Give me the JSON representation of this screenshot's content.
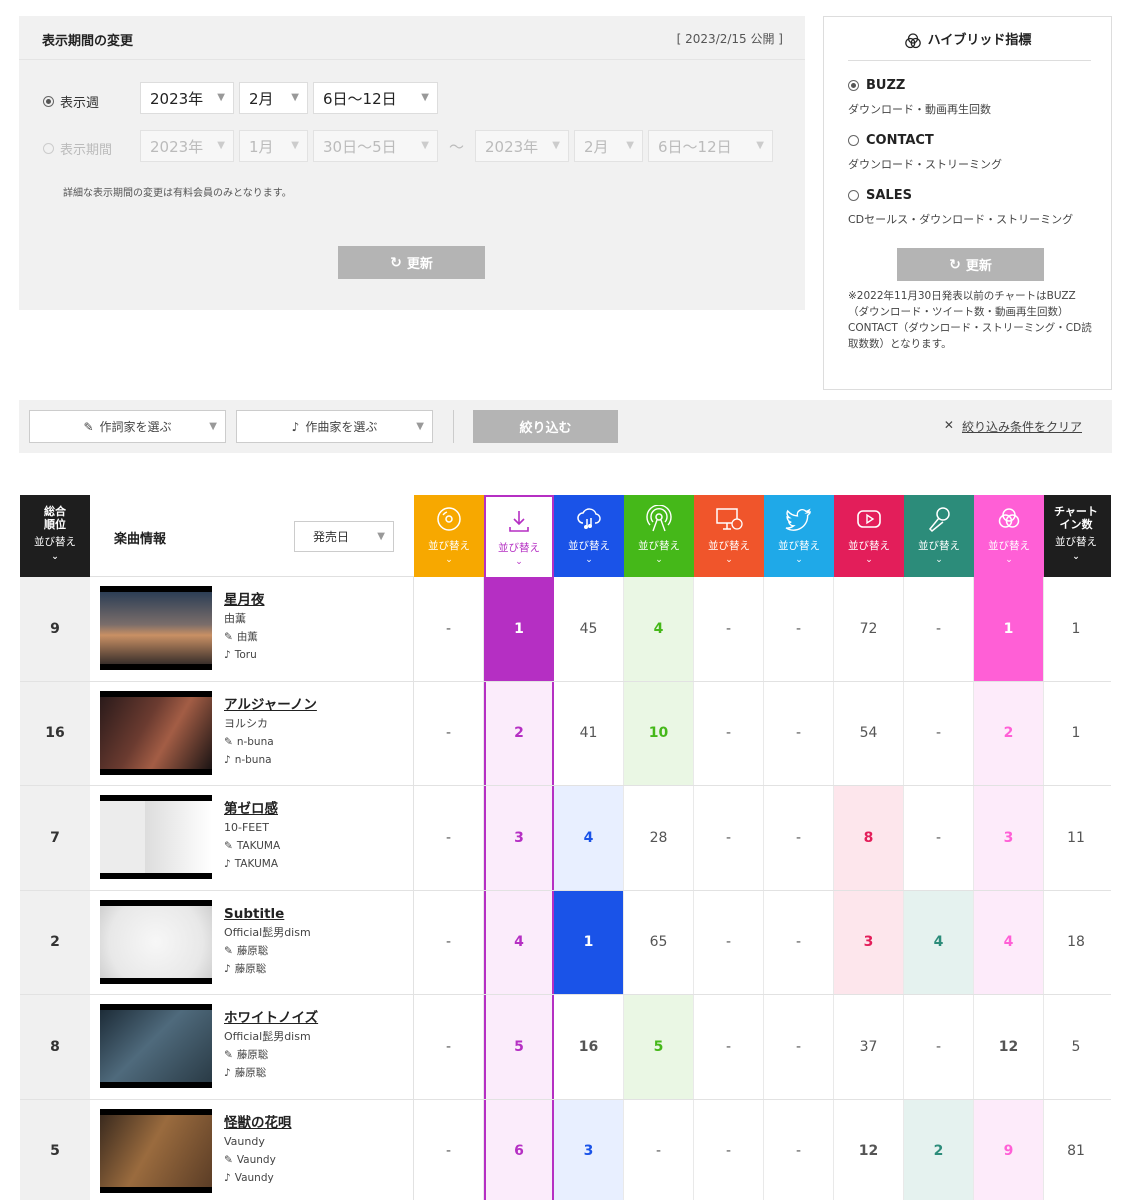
{
  "period": {
    "title": "表示期間の変更",
    "published": "[ 2023/2/15 公開 ]",
    "week_label": "表示週",
    "week_year": "2023年",
    "week_month": "2月",
    "week_range": "6日〜12日",
    "range_label": "表示期間",
    "from_year": "2023年",
    "from_month": "1月",
    "from_day": "30日〜5日",
    "tilde": "〜",
    "to_year": "2023年",
    "to_month": "2月",
    "to_day": "6日〜12日",
    "note": "詳細な表示期間の変更は有料会員のみとなります。",
    "update_label": "更新"
  },
  "hybrid": {
    "title": "ハイブリッド指標",
    "options": [
      {
        "label": "BUZZ",
        "desc": "ダウンロード・動画再生回数"
      },
      {
        "label": "CONTACT",
        "desc": "ダウンロード・ストリーミング"
      },
      {
        "label": "SALES",
        "desc": "CDセールス・ダウンロード・ストリーミング"
      }
    ],
    "update_label": "更新",
    "note": "※2022年11月30日発表以前のチャートはBUZZ（ダウンロード・ツイート数・動画再生回数）CONTACT（ダウンロード・ストリーミング・CD読取数数）となります。"
  },
  "filter": {
    "lyricist": "作詞家を選ぶ",
    "composer": "作曲家を選ぶ",
    "apply": "絞り込む",
    "clear": "絞り込み条件をクリア"
  },
  "table": {
    "rank_header": "総合順位",
    "sort": "並び替え",
    "info_header": "楽曲情報",
    "date_select": "発売日",
    "chart_header": "チャートイン数",
    "metric_colors": [
      "#f7a800",
      "#ffffff",
      "#1a53e8",
      "#45b819",
      "#f0552b",
      "#1fa9e8",
      "#e31e5a",
      "#2c8c7a",
      "#ff5fd6"
    ],
    "metric_icons": [
      "cd-icon",
      "download-icon",
      "streaming-icon",
      "radio-icon",
      "pc-icon",
      "twitter-icon",
      "youtube-icon",
      "karaoke-icon",
      "hybrid-icon"
    ],
    "rows": [
      {
        "rank": "9",
        "title": "星月夜",
        "artist": "由薫",
        "lyricist": "由薫",
        "composer": "Toru",
        "metrics": [
          "-",
          "1",
          "45",
          "4",
          "-",
          "-",
          "72",
          "-",
          "1"
        ],
        "chartin": "1"
      },
      {
        "rank": "16",
        "title": "アルジャーノン",
        "artist": "ヨルシカ",
        "lyricist": "n-buna",
        "composer": "n-buna",
        "metrics": [
          "-",
          "2",
          "41",
          "10",
          "-",
          "-",
          "54",
          "-",
          "2"
        ],
        "chartin": "1"
      },
      {
        "rank": "7",
        "title": "第ゼロ感",
        "artist": "10-FEET",
        "lyricist": "TAKUMA",
        "composer": "TAKUMA",
        "metrics": [
          "-",
          "3",
          "4",
          "28",
          "-",
          "-",
          "8",
          "-",
          "3"
        ],
        "chartin": "11"
      },
      {
        "rank": "2",
        "title": "Subtitle",
        "artist": "Official髭男dism",
        "lyricist": "藤原聡",
        "composer": "藤原聡",
        "metrics": [
          "-",
          "4",
          "1",
          "65",
          "-",
          "-",
          "3",
          "4",
          "4"
        ],
        "chartin": "18"
      },
      {
        "rank": "8",
        "title": "ホワイトノイズ",
        "artist": "Official髭男dism",
        "lyricist": "藤原聡",
        "composer": "藤原聡",
        "metrics": [
          "-",
          "5",
          "16",
          "5",
          "-",
          "-",
          "37",
          "-",
          "12"
        ],
        "chartin": "5"
      },
      {
        "rank": "5",
        "title": "怪獣の花唄",
        "artist": "Vaundy",
        "lyricist": "Vaundy",
        "composer": "Vaundy",
        "metrics": [
          "-",
          "6",
          "3",
          "-",
          "-",
          "-",
          "12",
          "2",
          "9"
        ],
        "chartin": "81"
      }
    ]
  }
}
